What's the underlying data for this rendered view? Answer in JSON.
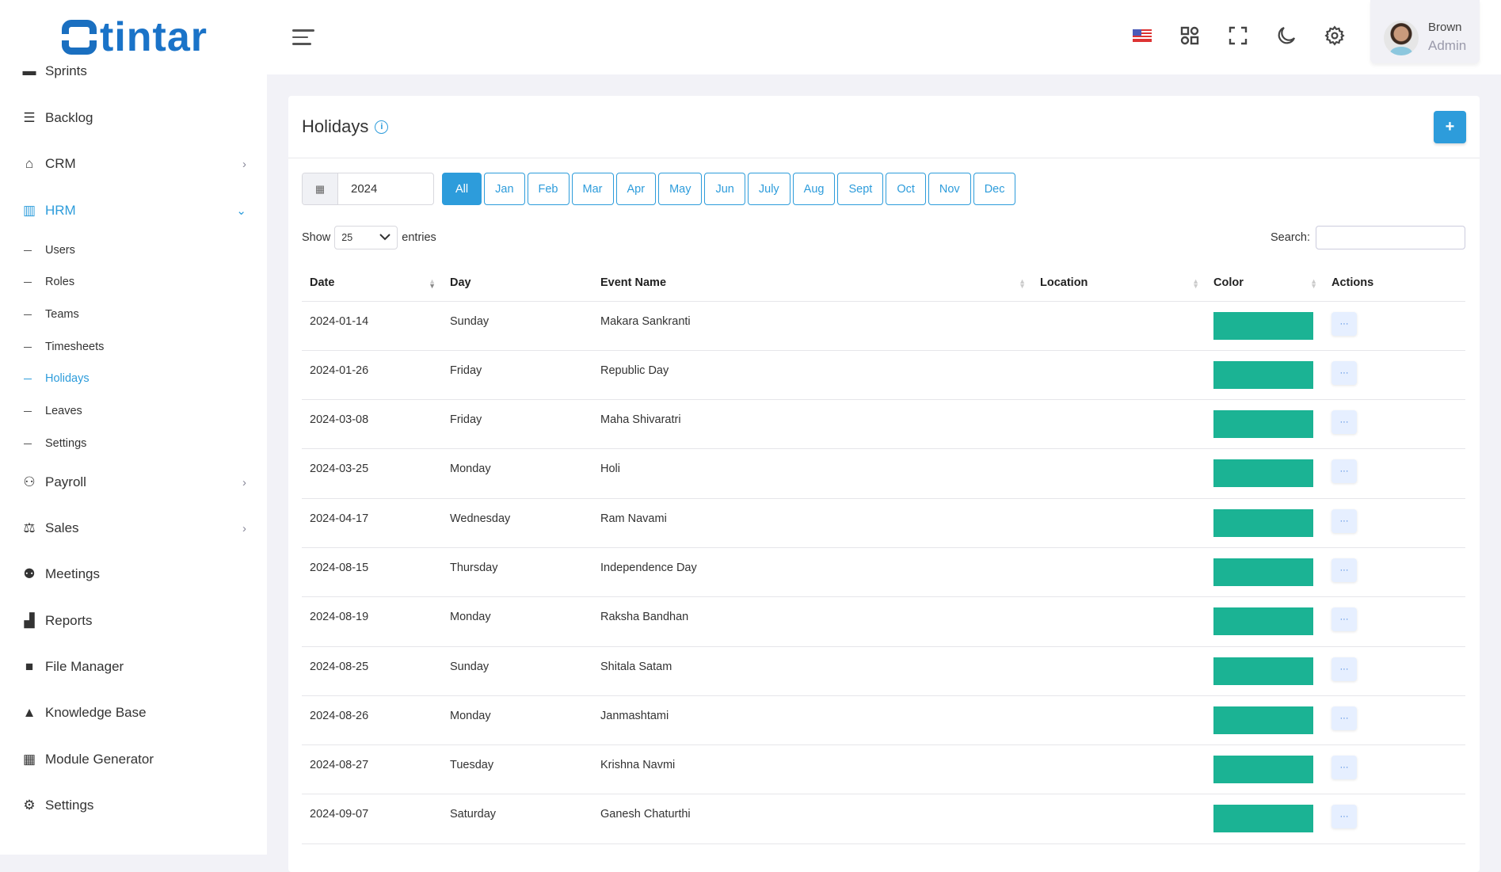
{
  "brand": {
    "logo_text": "tintar",
    "logo_full": "Stintar"
  },
  "sidebar": {
    "items": [
      {
        "label": "Sprints",
        "icon": "sprints-icon"
      },
      {
        "label": "Backlog",
        "icon": "backlog-icon"
      },
      {
        "label": "CRM",
        "icon": "crm-icon"
      },
      {
        "label": "HRM",
        "icon": "hrm-icon"
      },
      {
        "label": "Payroll",
        "icon": "payroll-icon"
      },
      {
        "label": "Sales",
        "icon": "sales-icon"
      },
      {
        "label": "Meetings",
        "icon": "meetings-icon"
      },
      {
        "label": "Reports",
        "icon": "reports-icon"
      },
      {
        "label": "File Manager",
        "icon": "folder-icon"
      },
      {
        "label": "Knowledge Base",
        "icon": "graduation-cap-icon"
      },
      {
        "label": "Module Generator",
        "icon": "grid-icon"
      },
      {
        "label": "Settings",
        "icon": "gear-icon"
      }
    ],
    "hrm_sub": [
      "Users",
      "Roles",
      "Teams",
      "Timesheets",
      "Holidays",
      "Leaves",
      "Settings"
    ],
    "active_sub": "Holidays"
  },
  "header": {
    "user_name": "Brown",
    "user_role": "Admin"
  },
  "page": {
    "title": "Holidays",
    "add_label": "+",
    "year": "2024",
    "months": [
      "All",
      "Jan",
      "Feb",
      "Mar",
      "Apr",
      "May",
      "Jun",
      "July",
      "Aug",
      "Sept",
      "Oct",
      "Nov",
      "Dec"
    ],
    "active_month": "All",
    "show_label": "Show",
    "entries_value": "25",
    "entries_label": "entries",
    "search_label": "Search:",
    "search_value": ""
  },
  "table": {
    "columns": [
      "Date",
      "Day",
      "Event Name",
      "Location",
      "Color",
      "Actions"
    ],
    "rows": [
      {
        "date": "2024-01-14",
        "day": "Sunday",
        "event": "Makara Sankranti",
        "location": "",
        "color": "#1bb394"
      },
      {
        "date": "2024-01-26",
        "day": "Friday",
        "event": "Republic Day",
        "location": "",
        "color": "#1bb394"
      },
      {
        "date": "2024-03-08",
        "day": "Friday",
        "event": "Maha Shivaratri",
        "location": "",
        "color": "#1bb394"
      },
      {
        "date": "2024-03-25",
        "day": "Monday",
        "event": "Holi",
        "location": "",
        "color": "#1bb394"
      },
      {
        "date": "2024-04-17",
        "day": "Wednesday",
        "event": "Ram Navami",
        "location": "",
        "color": "#1bb394"
      },
      {
        "date": "2024-08-15",
        "day": "Thursday",
        "event": "Independence Day",
        "location": "",
        "color": "#1bb394"
      },
      {
        "date": "2024-08-19",
        "day": "Monday",
        "event": "Raksha Bandhan",
        "location": "",
        "color": "#1bb394"
      },
      {
        "date": "2024-08-25",
        "day": "Sunday",
        "event": "Shitala Satam",
        "location": "",
        "color": "#1bb394"
      },
      {
        "date": "2024-08-26",
        "day": "Monday",
        "event": "Janmashtami",
        "location": "",
        "color": "#1bb394"
      },
      {
        "date": "2024-08-27",
        "day": "Tuesday",
        "event": "Krishna Navmi",
        "location": "",
        "color": "#1bb394"
      },
      {
        "date": "2024-09-07",
        "day": "Saturday",
        "event": "Ganesh Chaturthi",
        "location": "",
        "color": "#1bb394"
      }
    ],
    "action_label": "···"
  },
  "colors": {
    "accent": "#2d9cdb",
    "holiday": "#1bb394"
  }
}
